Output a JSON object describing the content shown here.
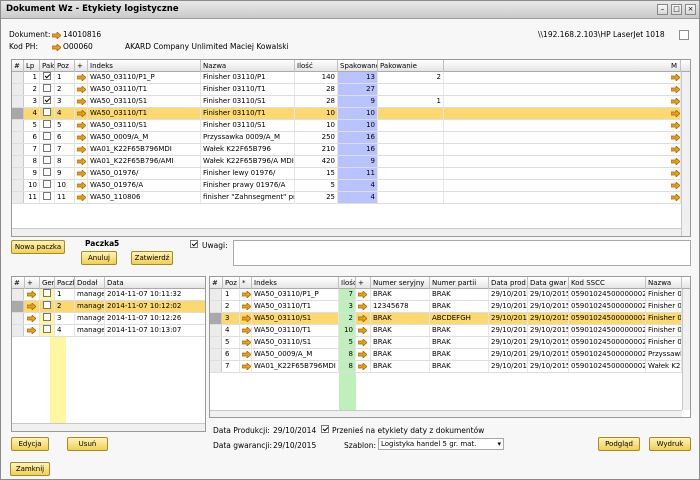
{
  "window": {
    "title": "Dokument Wz - Etykiety logistyczne"
  },
  "header": {
    "dokument_label": "Dokument:",
    "dokument_value": "14010816",
    "kod_label": "Kod PH:",
    "kod_value": "O00060",
    "company": "AKARD Company Unlimited Maciej Kowalski",
    "printer": "\\\\192.168.2.103\\HP LaserJet 1018"
  },
  "top_table": {
    "columns": [
      "#",
      "Lp",
      "Pak",
      "Poz",
      "+",
      "Indeks",
      "Nazwa",
      "Ilość",
      "Spakowano",
      "Pakowanie",
      "M"
    ],
    "rows": [
      {
        "lp": "1",
        "pak": true,
        "poz": "1",
        "indeks": "WA50_03110/P1_P",
        "nazwa": "Finisher 03110/P1",
        "ilosc": "140",
        "spak": "13",
        "pakowanie": "2",
        "sel": false
      },
      {
        "lp": "2",
        "pak": false,
        "poz": "2",
        "indeks": "WA50_03110/T1",
        "nazwa": "Finisher 03110/T1",
        "ilosc": "28",
        "spak": "27",
        "pakowanie": "",
        "sel": false
      },
      {
        "lp": "3",
        "pak": true,
        "poz": "3",
        "indeks": "WA50_03110/S1",
        "nazwa": "Finisher 03110/S1",
        "ilosc": "28",
        "spak": "9",
        "pakowanie": "1",
        "sel": false
      },
      {
        "lp": "4",
        "pak": false,
        "poz": "4",
        "indeks": "WA50_03110/T1",
        "nazwa": "Finisher 03110/T1",
        "ilosc": "10",
        "spak": "10",
        "pakowanie": "",
        "sel": true
      },
      {
        "lp": "5",
        "pak": false,
        "poz": "5",
        "indeks": "WA50_03110/S1",
        "nazwa": "Finisher 03110/S1",
        "ilosc": "10",
        "spak": "10",
        "pakowanie": "",
        "sel": false
      },
      {
        "lp": "6",
        "pak": false,
        "poz": "6",
        "indeks": "WA50_0009/A_M",
        "nazwa": "Przyssawka 0009/A_M",
        "ilosc": "250",
        "spak": "16",
        "pakowanie": "",
        "sel": false
      },
      {
        "lp": "7",
        "pak": false,
        "poz": "7",
        "indeks": "WA01_K22F65B796MDI",
        "nazwa": "Wałek K22F65B796",
        "ilosc": "210",
        "spak": "16",
        "pakowanie": "",
        "sel": false
      },
      {
        "lp": "8",
        "pak": false,
        "poz": "8",
        "indeks": "WA01_K22F65B796/AMI",
        "nazwa": "Wałek K22F65B796/A MDI",
        "ilosc": "420",
        "spak": "9",
        "pakowanie": "",
        "sel": false
      },
      {
        "lp": "9",
        "pak": false,
        "poz": "9",
        "indeks": "WA50_01976/",
        "nazwa": "Finisher lewy 01976/",
        "ilosc": "15",
        "spak": "11",
        "pakowanie": "",
        "sel": false
      },
      {
        "lp": "10",
        "pak": false,
        "poz": "10",
        "indeks": "WA50_01976/A",
        "nazwa": "Finisher prawy 01976/A",
        "ilosc": "5",
        "spak": "4",
        "pakowanie": "",
        "sel": false
      },
      {
        "lp": "11",
        "pak": false,
        "poz": "11",
        "indeks": "WA50_110806",
        "nazwa": "finisher \"Zahnsegment\" prawy 110806",
        "ilosc": "25",
        "spak": "4",
        "pakowanie": "",
        "sel": false
      }
    ]
  },
  "middle": {
    "nowa_paczka": "Nowa paczka",
    "paczka_label": "Paczka:",
    "paczka_value": "5",
    "anuluj": "Anuluj",
    "zatwierdz": "Zatwierdź",
    "uwagi_label": "Uwagi:"
  },
  "left_table": {
    "columns": [
      "#",
      "+",
      "Gen",
      "Paczka",
      "Dodał",
      "Data"
    ],
    "rows": [
      {
        "paczka": "1",
        "dodal": "manager",
        "data": "2014-11-07 10:11:32",
        "sel": false
      },
      {
        "paczka": "2",
        "dodal": "manager",
        "data": "2014-11-07 10:12:02",
        "sel": true
      },
      {
        "paczka": "3",
        "dodal": "manager",
        "data": "2014-11-07 10:12:26",
        "sel": false
      },
      {
        "paczka": "4",
        "dodal": "manager",
        "data": "2014-11-07 10:13:07",
        "sel": false
      }
    ]
  },
  "right_table": {
    "columns": [
      "#",
      "Poz",
      "*",
      "Indeks",
      "Ilość",
      "+",
      "Numer seryjny",
      "Numer partii",
      "Data prod",
      "Data gwar",
      "Kod SSCC",
      "Nazwa"
    ],
    "rows": [
      {
        "poz": "1",
        "indeks": "WA50_03110/P1_P",
        "ilosc": "7",
        "seryjny": "BRAK",
        "partii": "BRAK",
        "prod": "29/10/2014",
        "gwar": "29/10/2015",
        "sscc": "059010245000000024",
        "nazwa": "Finisher 03",
        "sel": false
      },
      {
        "poz": "2",
        "indeks": "WA50_03110/T1",
        "ilosc": "3",
        "seryjny": "12345678",
        "partii": "BRAK",
        "prod": "29/10/2014",
        "gwar": "29/10/2015",
        "sscc": "059010245000000024",
        "nazwa": "Finisher 03",
        "sel": false
      },
      {
        "poz": "3",
        "indeks": "WA50_03110/S1",
        "ilosc": "2",
        "seryjny": "BRAK",
        "partii": "ABCDEFGH",
        "prod": "29/10/2014",
        "gwar": "29/10/2015",
        "sscc": "059010245000000024",
        "nazwa": "Finisher 03",
        "sel": true
      },
      {
        "poz": "4",
        "indeks": "WA50_03110/T1",
        "ilosc": "10",
        "seryjny": "BRAK",
        "partii": "BRAK",
        "prod": "29/10/2014",
        "gwar": "29/10/2015",
        "sscc": "059010245000000024",
        "nazwa": "Finisher 03",
        "sel": false
      },
      {
        "poz": "5",
        "indeks": "WA50_03110/S1",
        "ilosc": "5",
        "seryjny": "BRAK",
        "partii": "BRAK",
        "prod": "29/10/2014",
        "gwar": "29/10/2015",
        "sscc": "059010245000000024",
        "nazwa": "Finisher 03",
        "sel": false
      },
      {
        "poz": "6",
        "indeks": "WA50_0009/A_M",
        "ilosc": "8",
        "seryjny": "BRAK",
        "partii": "BRAK",
        "prod": "29/10/2014",
        "gwar": "29/10/2015",
        "sscc": "059010245000000024",
        "nazwa": "Przyssawk",
        "sel": false
      },
      {
        "poz": "7",
        "indeks": "WA01_K22F65B796MDI",
        "ilosc": "8",
        "seryjny": "BRAK",
        "partii": "BRAK",
        "prod": "29/10/2014",
        "gwar": "29/10/2015",
        "sscc": "059010245000000024",
        "nazwa": "Wałek K22",
        "sel": false
      }
    ]
  },
  "bottom": {
    "data_prod_label": "Data Produkcji:",
    "data_prod_value": "29/10/2014",
    "przenies_label": "Przenieś na etykiety daty z dokumentów",
    "data_gwar_label": "Data gwarancji:",
    "data_gwar_value": "29/10/2015",
    "szablon_label": "Szablon:",
    "szablon_value": "Logistyka handel 5 gr. mat.",
    "edycja": "Edycja",
    "usun": "Usuń",
    "podglad": "Podgląd",
    "wydruk": "Wydruk",
    "zamknij": "Zamknij"
  },
  "colors": {
    "selected_row": "#fbd870",
    "button": "#f2cf55",
    "arrow": "#e7a21a",
    "green_col": "#bff0bc",
    "blue_col": "#b9c3ff"
  }
}
